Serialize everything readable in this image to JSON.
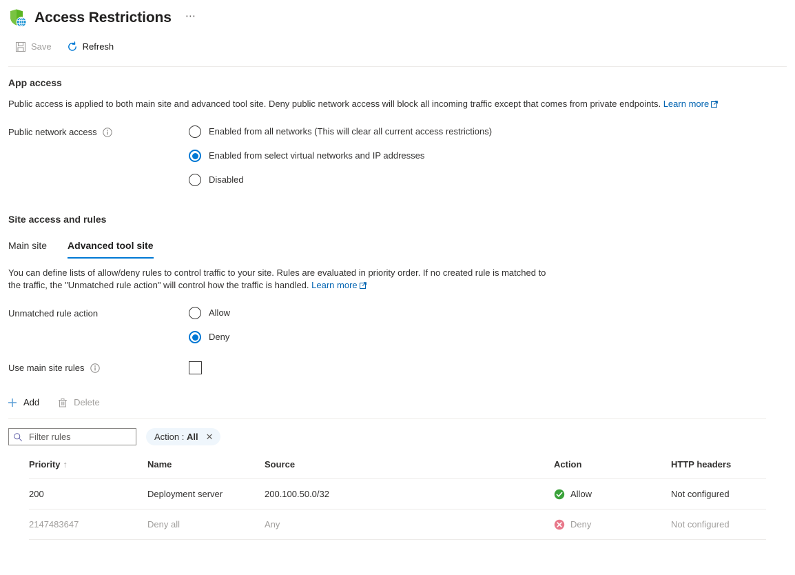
{
  "header": {
    "title": "Access Restrictions",
    "icon": "shield-globe-icon",
    "more_label": "⋯"
  },
  "command_bar": {
    "items": [
      {
        "label": "Save",
        "icon": "save-icon",
        "enabled": false
      },
      {
        "label": "Refresh",
        "icon": "refresh-icon",
        "enabled": true
      }
    ]
  },
  "app_access": {
    "title": "App access",
    "description": "Public access is applied to both main site and advanced tool site. Deny public network access will block all incoming traffic except that comes from private endpoints.",
    "learn_more": "Learn more",
    "field_label": "Public network access",
    "options": [
      {
        "label": "Enabled from all networks (This will clear all current access restrictions)",
        "checked": false
      },
      {
        "label": "Enabled from select virtual networks and IP addresses",
        "checked": true
      },
      {
        "label": "Disabled",
        "checked": false
      }
    ]
  },
  "site_access": {
    "title": "Site access and rules",
    "tabs": [
      {
        "label": "Main site",
        "active": false
      },
      {
        "label": "Advanced tool site",
        "active": true
      }
    ],
    "description": "You can define lists of allow/deny rules to control traffic to your site. Rules are evaluated in priority order. If no created rule is matched to the traffic, the \"Unmatched rule action\" will control how the traffic is handled.",
    "learn_more": "Learn more",
    "unmatched_label": "Unmatched rule action",
    "unmatched_options": [
      {
        "label": "Allow",
        "checked": false
      },
      {
        "label": "Deny",
        "checked": true
      }
    ],
    "use_main_site_rules_label": "Use main site rules",
    "use_main_site_rules_checked": false
  },
  "grid_toolbar": {
    "items": [
      {
        "label": "Add",
        "icon": "plus-icon",
        "enabled": true
      },
      {
        "label": "Delete",
        "icon": "trash-icon",
        "enabled": false
      }
    ]
  },
  "filter_bar": {
    "search_placeholder": "Filter rules",
    "search_value": "",
    "search_icon": "search-icon",
    "pill_prefix": "Action :",
    "pill_value": "All",
    "pill_close": "✕"
  },
  "table": {
    "columns": [
      {
        "label": "Priority",
        "sort": "↑"
      },
      {
        "label": "Name",
        "sort": ""
      },
      {
        "label": "Source",
        "sort": ""
      },
      {
        "label": "Action",
        "sort": ""
      },
      {
        "label": "HTTP headers",
        "sort": ""
      }
    ],
    "rows": [
      {
        "priority": "200",
        "name": "Deployment server",
        "source": "200.100.50.0/32",
        "action": "Allow",
        "action_status": "allow",
        "http_headers": "Not configured",
        "dim": false
      },
      {
        "priority": "2147483647",
        "name": "Deny all",
        "source": "Any",
        "action": "Deny",
        "action_status": "deny",
        "http_headers": "Not configured",
        "dim": true
      }
    ]
  },
  "colors": {
    "accent": "#0078d4",
    "link": "#0063b1",
    "allow_green": "#3aa23a",
    "deny_red": "#e8788a",
    "pill_bg": "#eff6fc",
    "text": "#323130",
    "disabled_text": "#a19f9d"
  }
}
